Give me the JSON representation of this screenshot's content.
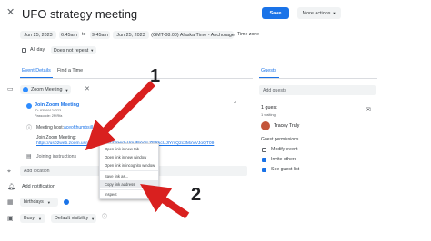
{
  "header": {
    "title": "UFO strategy meeting",
    "save_label": "Save",
    "more_actions_label": "More actions"
  },
  "datetime": {
    "start_date": "Jun 25, 2023",
    "start_time": "6:45am",
    "to_label": "to",
    "end_time": "9:45am",
    "end_date": "Jun 25, 2023",
    "timezone": "(GMT-08:00) Alaska Time - Anchorage",
    "timezone_link": "Time zone",
    "all_day_label": "All day",
    "repeat": "Does not repeat"
  },
  "tabs": {
    "event_details": "Event Details",
    "find_time": "Find a Time"
  },
  "conference": {
    "add_button": "Zoom Meeting",
    "join_title": "Join Zoom Meeting",
    "meeting_id": "ID: 83569124323",
    "passcode": "Passcode: 2PIRfa",
    "host_label": "Meeting host:",
    "host_email": "aceofthumbsill",
    "join_label": "Join Zoom Meeting:",
    "join_link": "https://us02web.zoom.us/j/8356914323?pwd=UmJBxVhLZERkcUJlYmQ2c3MxVVJoQT09",
    "instructions": "Joining instructions"
  },
  "context_menu": {
    "items": [
      "Open link in new tab",
      "Open link in new window",
      "Open link in incognito window",
      "Save link as...",
      "Copy link address",
      "Inspect"
    ]
  },
  "location_placeholder": "Add location",
  "notification_label": "Add notification",
  "calendar": {
    "name": "birthdays",
    "color": "#1a73e8"
  },
  "availability": {
    "status": "Busy",
    "visibility": "Default visibility"
  },
  "guests_panel": {
    "tab": "Guests",
    "add_placeholder": "Add guests",
    "guest_count": "1 guest",
    "waiting": "1 waiting",
    "guest_name": "Tracey Truly",
    "permissions_title": "Guest permissions",
    "permissions": [
      {
        "label": "Modify event",
        "checked": false
      },
      {
        "label": "Invite others",
        "checked": true
      },
      {
        "label": "See guest list",
        "checked": true
      }
    ]
  },
  "annotations": {
    "arrow1_label": "1",
    "arrow2_label": "2",
    "arrow_color": "#d9201f"
  }
}
